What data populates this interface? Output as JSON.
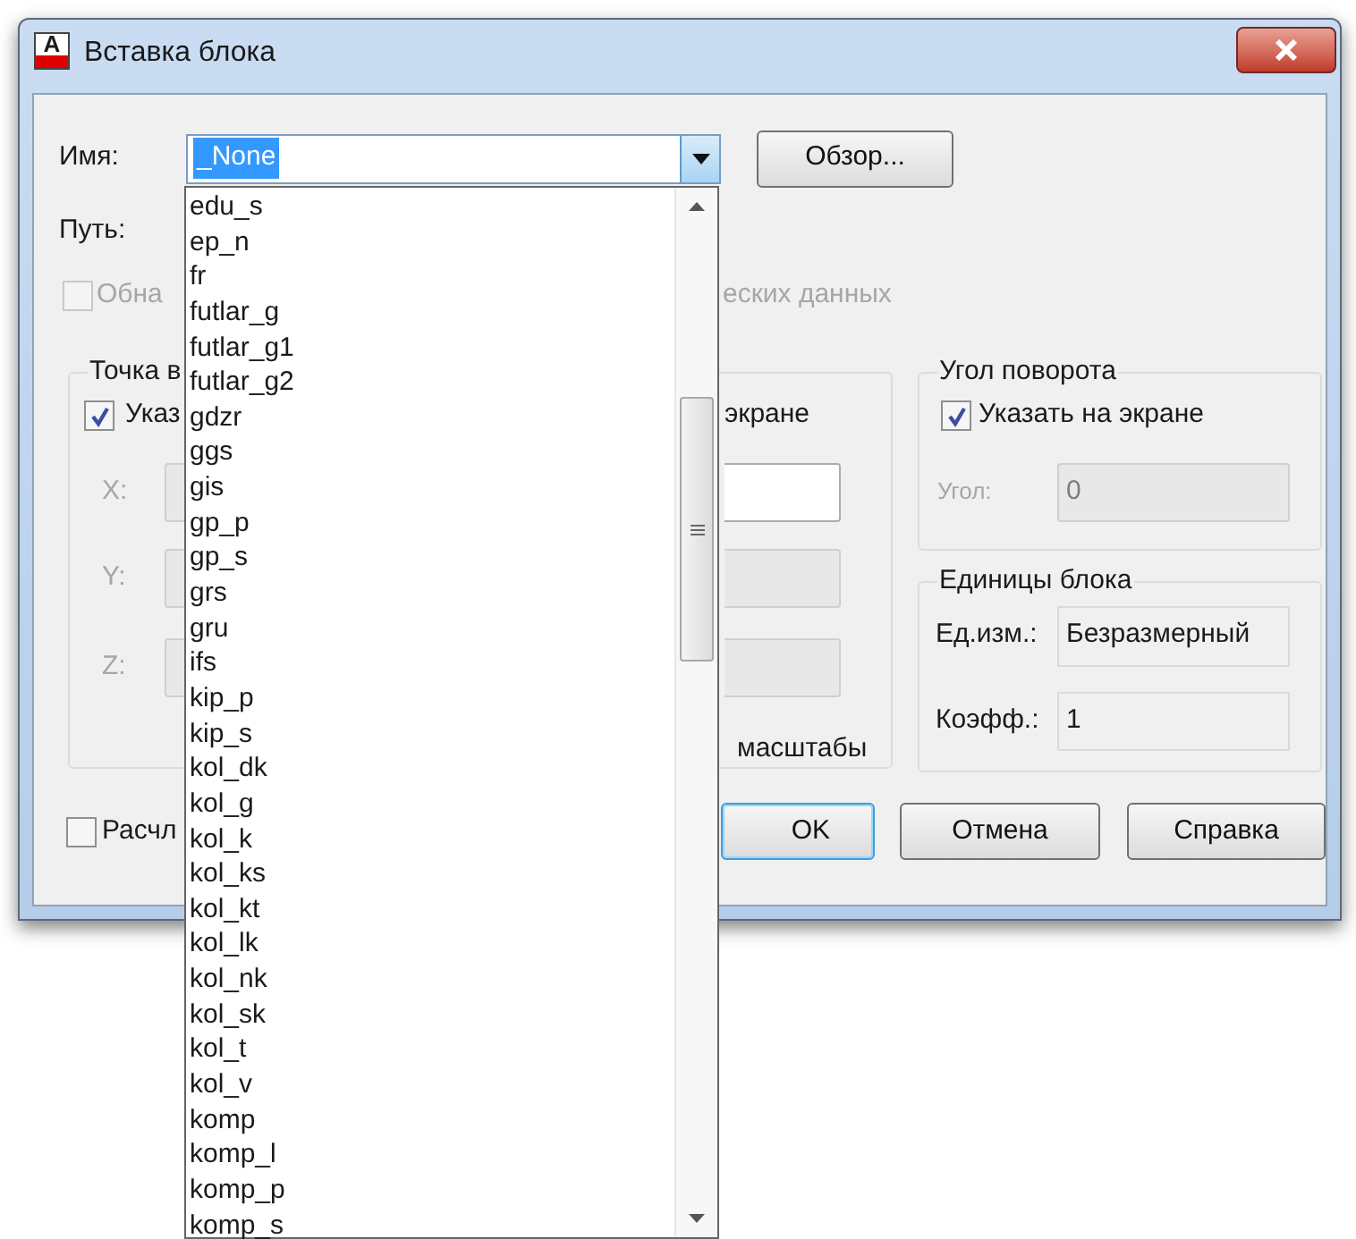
{
  "window": {
    "title": "Вставка блока",
    "icon_letter": "A"
  },
  "name_field": {
    "label": "Имя:",
    "value": "_None",
    "text_selected": true
  },
  "browse_button": "Обзор...",
  "path": {
    "label": "Путь:"
  },
  "geo_checkbox": {
    "label_left": "Обна",
    "label_right": "еских данных",
    "checked": false,
    "disabled": true
  },
  "insertion_point": {
    "title": "Точка в",
    "specify_on_screen": {
      "label": "Указ",
      "checked": true
    },
    "fields": [
      {
        "label": "X:",
        "disabled": true
      },
      {
        "label": "Y:",
        "disabled": true
      },
      {
        "label": "Z:",
        "disabled": true
      }
    ]
  },
  "scale": {
    "specify_on_screen_label": "экране",
    "fields": [
      {
        "disabled": false
      },
      {
        "disabled": true
      },
      {
        "disabled": true
      }
    ],
    "uniform_label": "масштабы"
  },
  "rotation": {
    "title": "Угол поворота",
    "specify_on_screen": {
      "label": "Указать на экране",
      "checked": true
    },
    "angle": {
      "label": "Угол:",
      "value": "0",
      "disabled": true
    }
  },
  "block_units": {
    "title": "Единицы блока",
    "units": {
      "label": "Ед.изм.:",
      "value": "Безразмерный"
    },
    "factor": {
      "label": "Коэфф.:",
      "value": "1"
    }
  },
  "explode": {
    "label": "Расчл",
    "checked": false
  },
  "buttons": [
    {
      "label": "OK",
      "default": true
    },
    {
      "label": "Отмена",
      "default": false
    },
    {
      "label": "Справка",
      "default": false
    }
  ],
  "dropdown": {
    "items": [
      "edu_s",
      "ep_n",
      "fr",
      "futlar_g",
      "futlar_g1",
      "futlar_g2",
      "gdzr",
      "ggs",
      "gis",
      "gp_p",
      "gp_s",
      "grs",
      "gru",
      "ifs",
      "kip_p",
      "kip_s",
      "kol_dk",
      "kol_g",
      "kol_k",
      "kol_ks",
      "kol_kt",
      "kol_lk",
      "kol_nk",
      "kol_sk",
      "kol_t",
      "kol_v",
      "komp",
      "komp_l",
      "komp_p",
      "komp_s"
    ]
  }
}
